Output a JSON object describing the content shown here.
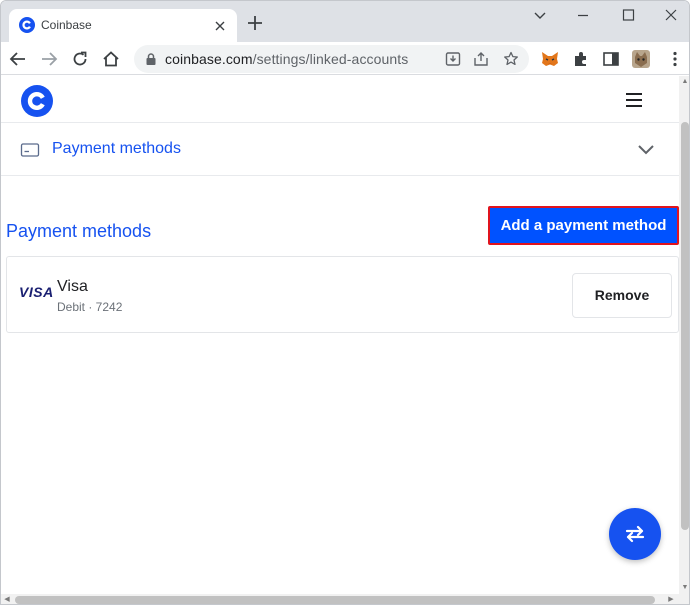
{
  "browser": {
    "tab_title": "Coinbase",
    "url_host": "coinbase.com",
    "url_path": "/settings/linked-accounts"
  },
  "colors": {
    "brand_blue": "#1652f0",
    "button_blue": "#0052ff",
    "highlight_red": "#e0141e",
    "visa_navy": "#1a1f71"
  },
  "icons": {
    "tab_favicon": "coinbase-logo-icon",
    "header_logo": "coinbase-logo-icon",
    "menu": "hamburger-menu-icon",
    "accordion": "credit-card-icon",
    "accordion_toggle": "chevron-down-icon",
    "fab": "swap-arrows-icon",
    "extensions": [
      "metamask-fox-icon",
      "puzzle-extensions-icon",
      "side-panel-icon",
      "profile-avatar-icon"
    ]
  },
  "accordion": {
    "title": "Payment methods"
  },
  "payment_section": {
    "title": "Payment methods",
    "add_button_label": "Add a payment method",
    "methods": [
      {
        "logo_text": "VISA",
        "name": "Visa",
        "detail": "Debit · 7242",
        "remove_label": "Remove"
      }
    ]
  }
}
